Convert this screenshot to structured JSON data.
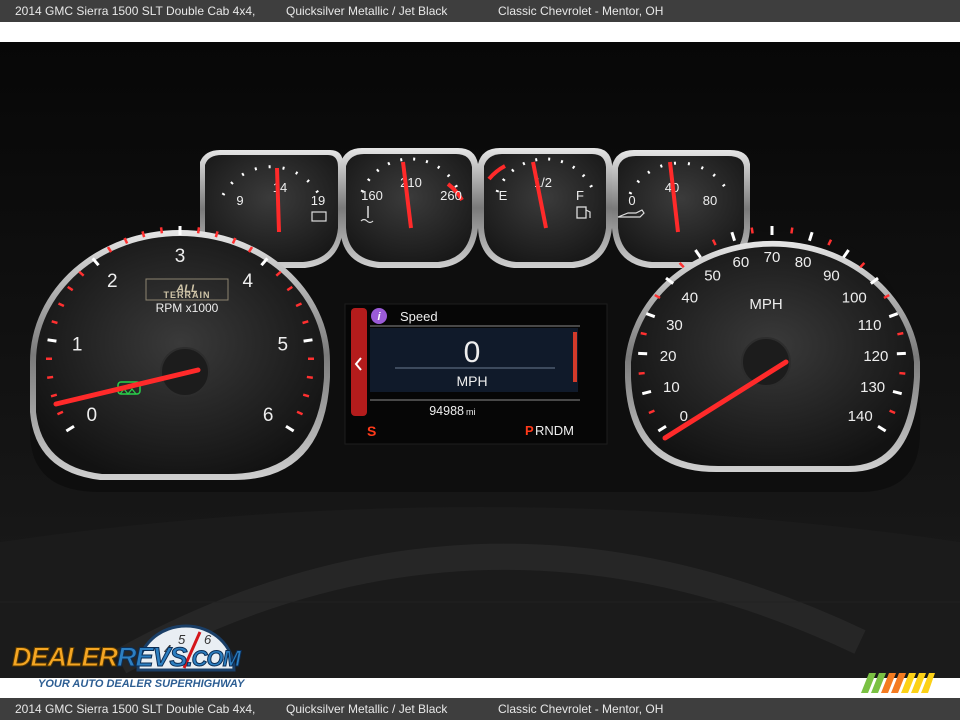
{
  "caption": {
    "vehicle": "2014 GMC Sierra 1500 SLT Double Cab 4x4,",
    "colors": "Quicksilver Metallic / Jet Black",
    "dealer": "Classic Chevrolet - Mentor, OH"
  },
  "tachometer": {
    "badge_line1": "ALL",
    "badge_line2": "TERRAIN",
    "unit": "RPM x1000",
    "ticks": [
      "0",
      "1",
      "2",
      "3",
      "4",
      "5",
      "6"
    ],
    "value_rpm_x1000": 0
  },
  "speedometer": {
    "unit": "MPH",
    "ticks": [
      "0",
      "10",
      "20",
      "30",
      "40",
      "50",
      "60",
      "70",
      "80",
      "90",
      "100",
      "110",
      "120",
      "130",
      "140"
    ],
    "value_mph": 0
  },
  "small_gauges": {
    "voltage": {
      "ticks": [
        "9",
        "14",
        "19"
      ],
      "icon": "battery-icon"
    },
    "temperature": {
      "ticks": [
        "160",
        "210",
        "260"
      ],
      "icon": "coolant-temp-icon"
    },
    "fuel": {
      "ticks": [
        "E",
        "1/2",
        "F"
      ],
      "icon": "fuel-pump-icon"
    },
    "oil": {
      "ticks": [
        "0",
        "40",
        "80"
      ],
      "icon": "oil-can-icon"
    }
  },
  "dic": {
    "title": "Speed",
    "value": "0",
    "unit": "MPH",
    "odometer": "94988",
    "odometer_unit": "mi",
    "left_indicator": "S",
    "gear_selected": "P",
    "gear_rest": "RNDM"
  },
  "watermark": {
    "dealer_part1": "DEALER",
    "dealer_part2": "REVS",
    "dealer_part3": ".COM",
    "tagline": "YOUR AUTO DEALER SUPERHIGHWAY"
  },
  "colors": {
    "needle": "#ff2a2a",
    "bezel": "#c8c8c8",
    "caption_bar": "#3e3e3e",
    "logo_orange": "#f5a623",
    "logo_blue": "#2d7fc1"
  }
}
